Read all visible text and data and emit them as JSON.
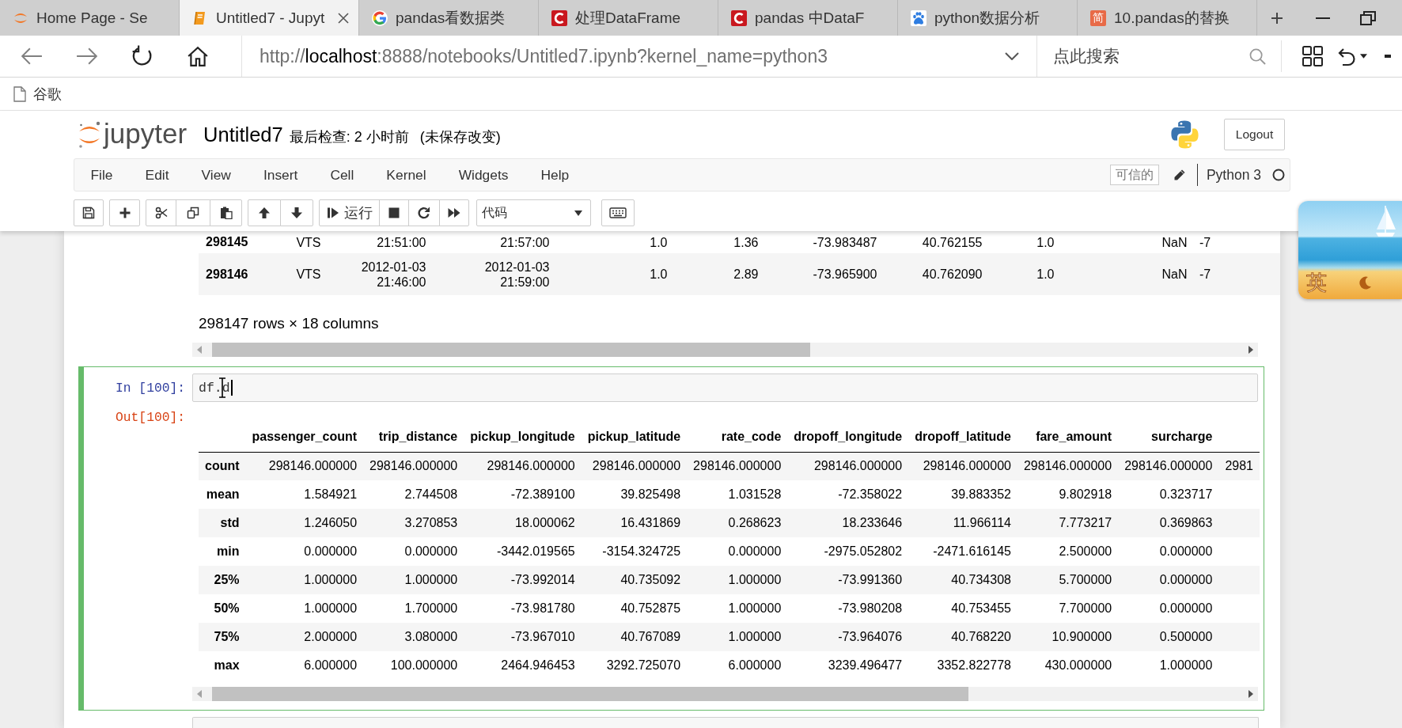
{
  "browser": {
    "tabs": [
      {
        "kind": "ring",
        "title": "Home Page - Se",
        "selected": false
      },
      {
        "kind": "book",
        "title": "Untitled7 - Jupyt",
        "selected": true
      },
      {
        "kind": "g-letter",
        "title": "pandas看数据类",
        "selected": false
      },
      {
        "kind": "c-letter",
        "title": "处理DataFrame",
        "selected": false
      },
      {
        "kind": "c-letter",
        "title": "pandas 中DataF",
        "selected": false
      },
      {
        "kind": "paw",
        "title": "python数据分析",
        "selected": false
      },
      {
        "kind": "badge",
        "badge": "简",
        "title": "10.pandas的替换",
        "selected": false
      }
    ],
    "url": "http://**localhost**:8888/notebooks/Untitled7.ipynb?kernel_name=python3",
    "search": {
      "placeholder": "点此搜索"
    },
    "bookmarks": [
      {
        "label": "谷歌"
      }
    ]
  },
  "notebook": {
    "logo_text": "jupyter",
    "name": "Untitled7",
    "checkpoint": "最后检查: 2 小时前",
    "autosave": "(未保存改变)",
    "logout": "Logout",
    "menu": [
      "File",
      "Edit",
      "View",
      "Insert",
      "Cell",
      "Kernel",
      "Widgets",
      "Help"
    ],
    "trusted": "可信的",
    "kernel": "Python 3",
    "kernel_busy": false,
    "toolbar": {
      "run_label": "运行",
      "cell_type": "代码"
    }
  },
  "previous_output": {
    "rows": [
      {
        "index": "298145",
        "values": [
          "VTS",
          "21:51:00",
          "21:57:00",
          "1.0",
          "1.36",
          "-73.983487",
          "40.762155",
          "1.0",
          "NaN",
          "-7"
        ]
      },
      {
        "index": "298146",
        "values": [
          "VTS",
          "2012-01-03 21:46:00",
          "2012-01-03 21:59:00",
          "1.0",
          "2.89",
          "-73.965900",
          "40.762090",
          "1.0",
          "NaN",
          "-7"
        ]
      }
    ],
    "summary": "298147 rows × 18 columns"
  },
  "cell": {
    "selected": true,
    "prompt_in": "In [100]:",
    "code": "df.d",
    "prompt_out": "Out[100]:",
    "table": {
      "columns": [
        "passenger_count",
        "trip_distance",
        "pickup_longitude",
        "pickup_latitude",
        "rate_code",
        "dropoff_longitude",
        "dropoff_latitude",
        "fare_amount",
        "surcharge"
      ],
      "rows": [
        {
          "index": "count",
          "values": [
            "298146.000000",
            "298146.000000",
            "298146.000000",
            "298146.000000",
            "298146.000000",
            "298146.000000",
            "298146.000000",
            "298146.000000",
            "298146.000000",
            "2981"
          ]
        },
        {
          "index": "mean",
          "values": [
            "1.584921",
            "2.744508",
            "-72.389100",
            "39.825498",
            "1.031528",
            "-72.358022",
            "39.883352",
            "9.802918",
            "0.323717"
          ]
        },
        {
          "index": "std",
          "values": [
            "1.246050",
            "3.270853",
            "18.000062",
            "16.431869",
            "0.268623",
            "18.233646",
            "11.966114",
            "7.773217",
            "0.369863"
          ]
        },
        {
          "index": "min",
          "values": [
            "0.000000",
            "0.000000",
            "-3442.019565",
            "-3154.324725",
            "0.000000",
            "-2975.052802",
            "-2471.616145",
            "2.500000",
            "0.000000"
          ]
        },
        {
          "index": "25%",
          "values": [
            "1.000000",
            "1.000000",
            "-73.992014",
            "40.735092",
            "1.000000",
            "-73.991360",
            "40.734308",
            "5.700000",
            "0.000000"
          ]
        },
        {
          "index": "50%",
          "values": [
            "1.000000",
            "1.700000",
            "-73.981780",
            "40.752875",
            "1.000000",
            "-73.980208",
            "40.753455",
            "7.700000",
            "0.000000"
          ]
        },
        {
          "index": "75%",
          "values": [
            "2.000000",
            "3.080000",
            "-73.967010",
            "40.767089",
            "1.000000",
            "-73.964076",
            "40.768220",
            "10.900000",
            "0.500000"
          ]
        },
        {
          "index": "max",
          "values": [
            "6.000000",
            "100.000000",
            "2464.946453",
            "3292.725070",
            "6.000000",
            "3239.496477",
            "3352.822778",
            "430.000000",
            "1.000000"
          ]
        }
      ]
    }
  },
  "ime": {
    "mode": "英"
  }
}
